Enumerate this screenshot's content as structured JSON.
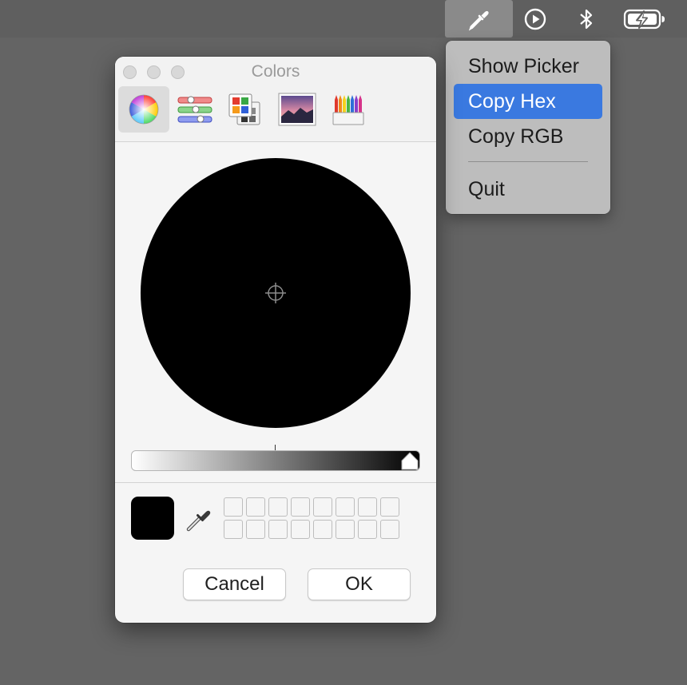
{
  "menubar": {
    "items": [
      {
        "icon": "eyedropper-icon"
      },
      {
        "icon": "play-circle-icon"
      },
      {
        "icon": "bluetooth-icon"
      },
      {
        "icon": "battery-charging-icon"
      }
    ]
  },
  "dropdown": {
    "items": [
      {
        "label": "Show Picker",
        "highlighted": false
      },
      {
        "label": "Copy Hex",
        "highlighted": true
      },
      {
        "label": "Copy RGB",
        "highlighted": false
      },
      {
        "label": "Quit",
        "highlighted": false
      }
    ],
    "highlight_color": "#3a79e0"
  },
  "colors_panel": {
    "title": "Colors",
    "toolbar": [
      {
        "icon": "color-wheel-icon",
        "selected": true
      },
      {
        "icon": "color-sliders-icon",
        "selected": false
      },
      {
        "icon": "color-palettes-icon",
        "selected": false
      },
      {
        "icon": "image-palettes-icon",
        "selected": false
      },
      {
        "icon": "pencils-icon",
        "selected": false
      }
    ],
    "current_color": "#000000",
    "brightness_fraction": 0,
    "swatch_slots": 16,
    "buttons": {
      "cancel": "Cancel",
      "ok": "OK"
    }
  }
}
